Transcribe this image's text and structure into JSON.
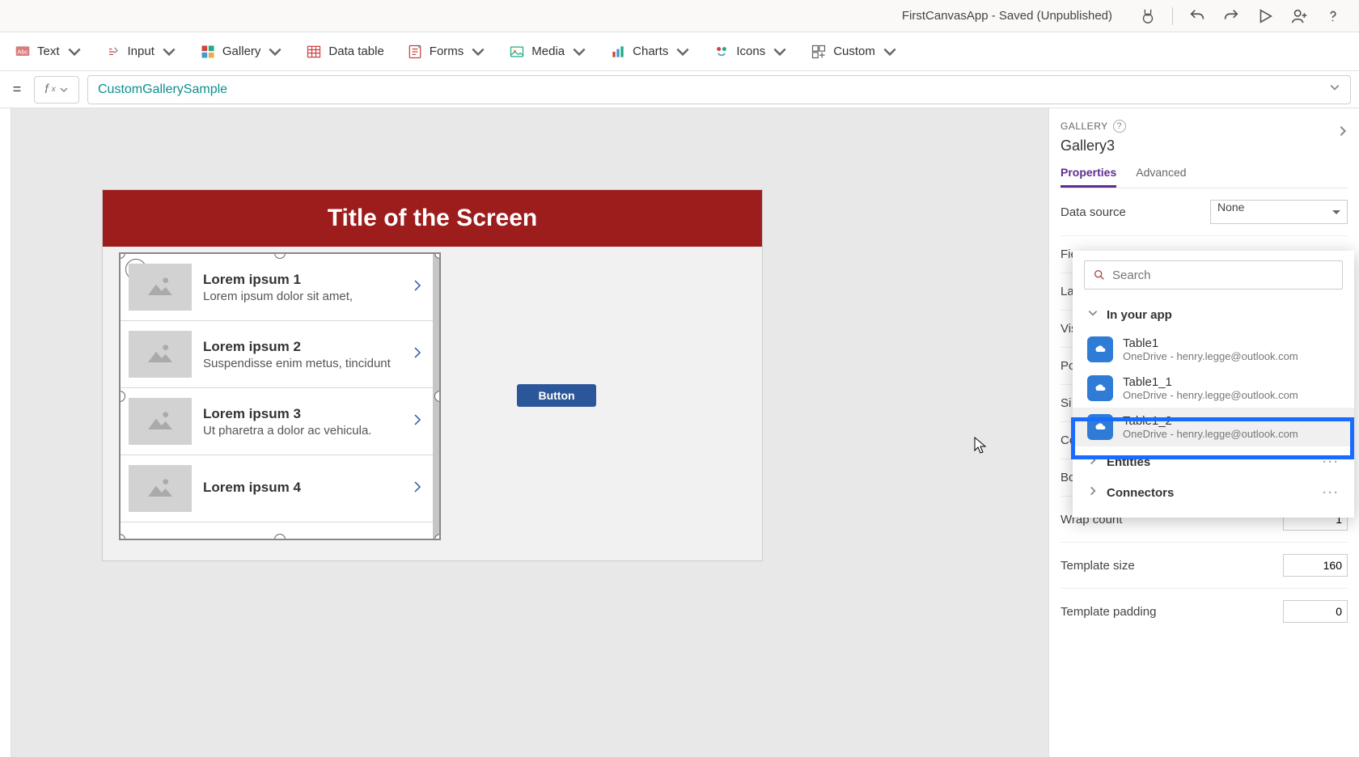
{
  "titlebar": {
    "app_title": "FirstCanvasApp - Saved (Unpublished)"
  },
  "ribbon": {
    "text": "Text",
    "input": "Input",
    "gallery": "Gallery",
    "data_table": "Data table",
    "forms": "Forms",
    "media": "Media",
    "charts": "Charts",
    "icons": "Icons",
    "custom": "Custom"
  },
  "formula": {
    "value": "CustomGallerySample"
  },
  "canvas": {
    "screen_title": "Title of the Screen",
    "button_label": "Button",
    "gallery_items": [
      {
        "title": "Lorem ipsum 1",
        "sub": "Lorem ipsum dolor sit amet,"
      },
      {
        "title": "Lorem ipsum 2",
        "sub": "Suspendisse enim metus, tincidunt"
      },
      {
        "title": "Lorem ipsum 3",
        "sub": "Ut pharetra a dolor ac vehicula."
      },
      {
        "title": "Lorem ipsum 4",
        "sub": ""
      }
    ]
  },
  "props": {
    "section_label": "GALLERY",
    "control_name": "Gallery3",
    "tab_properties": "Properties",
    "tab_advanced": "Advanced",
    "rows": {
      "data_source": "Data source",
      "data_source_value": "None",
      "fields": "Fie",
      "layout": "La",
      "visible": "Vis",
      "position": "Po",
      "size": "Si",
      "color": "Co",
      "border": "Bo",
      "wrap_count": "Wrap count",
      "wrap_count_value": "1",
      "template_size": "Template size",
      "template_size_value": "160",
      "template_padding": "Template padding",
      "template_padding_value": "0"
    }
  },
  "flyout": {
    "search_placeholder": "Search",
    "in_your_app": "In your app",
    "entities": "Entities",
    "connectors": "Connectors",
    "items": [
      {
        "name": "Table1",
        "sub": "OneDrive - henry.legge@outlook.com"
      },
      {
        "name": "Table1_1",
        "sub": "OneDrive - henry.legge@outlook.com"
      },
      {
        "name": "Table1_2",
        "sub": "OneDrive - henry.legge@outlook.com"
      }
    ]
  }
}
